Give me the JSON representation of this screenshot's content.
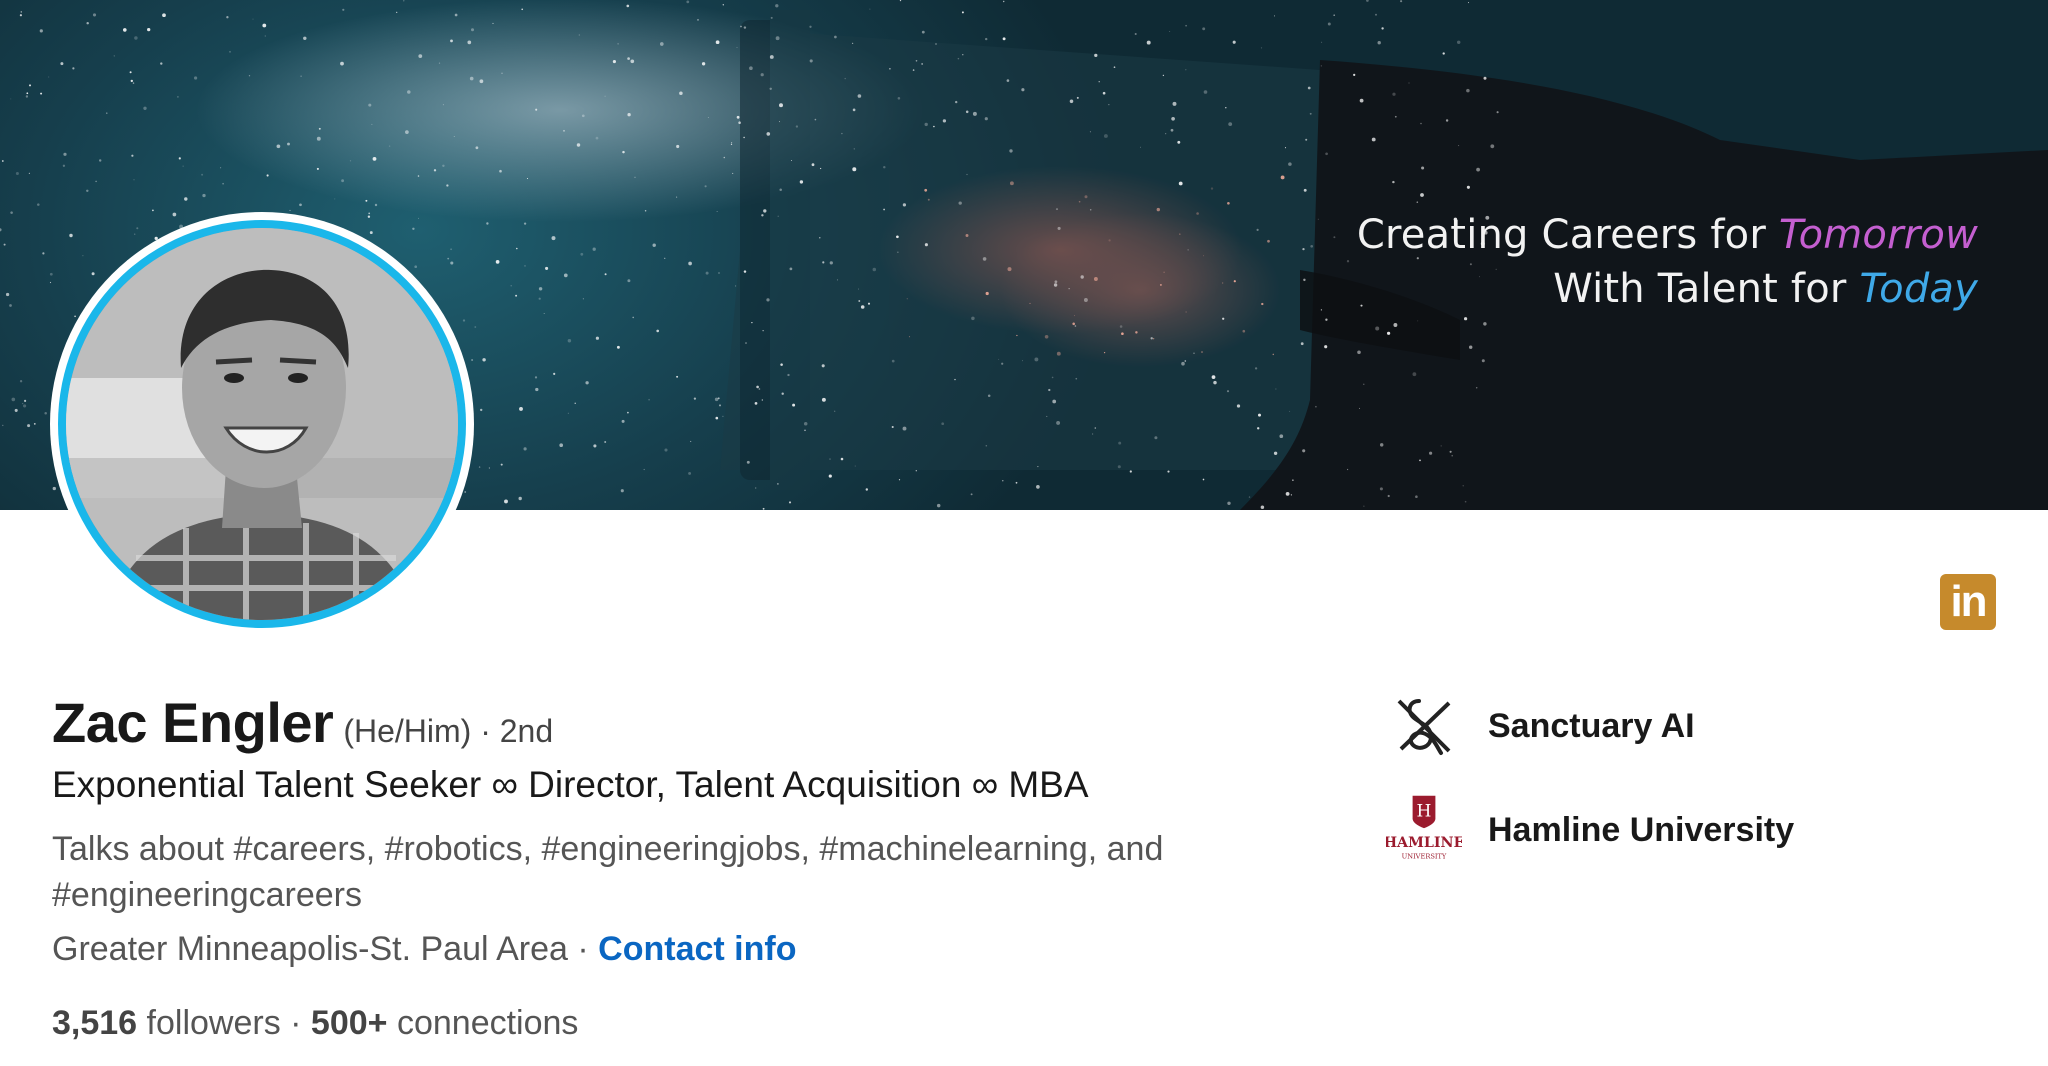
{
  "banner": {
    "tagline_line1_prefix": "Creating Careers for ",
    "tagline_line1_accent": "Tomorrow",
    "tagline_line2_prefix": "With Talent for ",
    "tagline_line2_accent": "Today",
    "accent_color_1": "#c45fd0",
    "accent_color_2": "#3fa9e8"
  },
  "profile": {
    "name": "Zac Engler",
    "pronouns": "(He/Him)",
    "degree": " · 2nd",
    "headline": "Exponential Talent Seeker ∞ Director, Talent Acquisition ∞ MBA",
    "talks_about": "Talks about #careers, #robotics, #engineeringjobs, #machinelearning, and #engineeringcareers",
    "location": "Greater Minneapolis-St. Paul Area",
    "location_separator": " · ",
    "contact_info": "Contact info",
    "followers_count": "3,516",
    "followers_label": " followers",
    "stats_separator": "  · ",
    "connections_count": "500+",
    "connections_label": " connections"
  },
  "organizations": [
    {
      "name": "Sanctuary AI",
      "icon": "sanctuary-ai-logo"
    },
    {
      "name": "Hamline University",
      "icon": "hamline-university-logo",
      "logo_text": "HAMLINE",
      "logo_subtext": "UNIVERSITY",
      "logo_letter": "H"
    }
  ],
  "colors": {
    "avatar_ring": "#1ab7ea",
    "link": "#0a66c2",
    "linkedin_badge": "#c68a2c",
    "hamline_red": "#9b1b2e"
  },
  "badge": {
    "text": "in",
    "icon": "linkedin-icon"
  }
}
